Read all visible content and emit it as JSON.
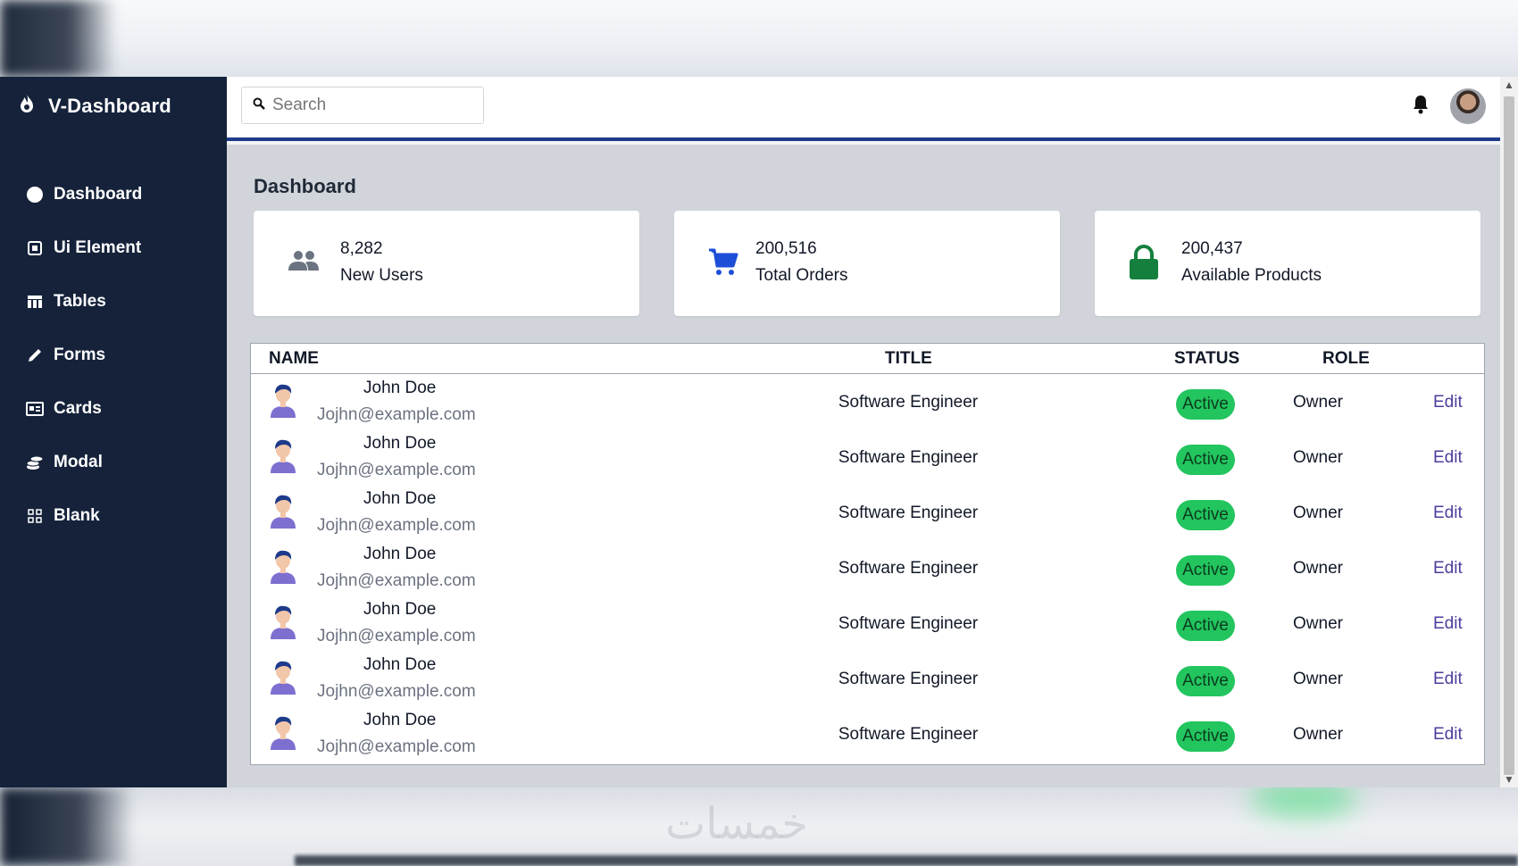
{
  "brand": {
    "name": "V-Dashboard",
    "icon": "flame-icon"
  },
  "sidebar": {
    "items": [
      {
        "label": "Dashboard",
        "icon": "circle-icon"
      },
      {
        "label": "Ui Element",
        "icon": "component-icon"
      },
      {
        "label": "Tables",
        "icon": "table-icon"
      },
      {
        "label": "Forms",
        "icon": "pencil-icon"
      },
      {
        "label": "Cards",
        "icon": "id-card-icon"
      },
      {
        "label": "Modal",
        "icon": "coins-icon"
      },
      {
        "label": "Blank",
        "icon": "grid-icon"
      }
    ]
  },
  "topbar": {
    "search_placeholder": "Search"
  },
  "page": {
    "title": "Dashboard"
  },
  "stats": [
    {
      "value": "8,282",
      "label": "New Users",
      "icon": "users-icon",
      "color": "#6b7280"
    },
    {
      "value": "200,516",
      "label": "Total Orders",
      "icon": "cart-icon",
      "color": "#1d4ed8"
    },
    {
      "value": "200,437",
      "label": "Available Products",
      "icon": "lock-icon",
      "color": "#15803d"
    }
  ],
  "table": {
    "headers": {
      "name": "NAME",
      "title": "TITLE",
      "status": "STATUS",
      "role": "ROLE"
    },
    "rows": [
      {
        "name": "John Doe",
        "email": "Jojhn@example.com",
        "title": "Software Engineer",
        "status": "Active",
        "role": "Owner",
        "action": "Edit"
      },
      {
        "name": "John Doe",
        "email": "Jojhn@example.com",
        "title": "Software Engineer",
        "status": "Active",
        "role": "Owner",
        "action": "Edit"
      },
      {
        "name": "John Doe",
        "email": "Jojhn@example.com",
        "title": "Software Engineer",
        "status": "Active",
        "role": "Owner",
        "action": "Edit"
      },
      {
        "name": "John Doe",
        "email": "Jojhn@example.com",
        "title": "Software Engineer",
        "status": "Active",
        "role": "Owner",
        "action": "Edit"
      },
      {
        "name": "John Doe",
        "email": "Jojhn@example.com",
        "title": "Software Engineer",
        "status": "Active",
        "role": "Owner",
        "action": "Edit"
      },
      {
        "name": "John Doe",
        "email": "Jojhn@example.com",
        "title": "Software Engineer",
        "status": "Active",
        "role": "Owner",
        "action": "Edit"
      },
      {
        "name": "John Doe",
        "email": "Jojhn@example.com",
        "title": "Software Engineer",
        "status": "Active",
        "role": "Owner",
        "action": "Edit"
      }
    ]
  },
  "watermark": "خمسات",
  "colors": {
    "sidebar": "#15223a",
    "accent": "#1e3a8a",
    "active_badge": "#22c55e",
    "edit_link": "#4c3d9e"
  }
}
